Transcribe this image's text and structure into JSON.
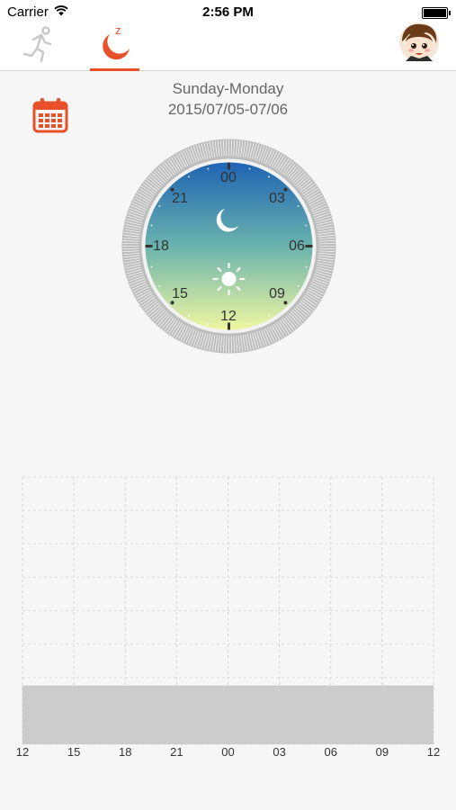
{
  "status_bar": {
    "carrier": "Carrier",
    "time": "2:56 PM"
  },
  "nav": {
    "tabs": [
      {
        "name": "activity",
        "icon": "running-man-icon",
        "active": false
      },
      {
        "name": "sleep",
        "icon": "moon-sleep-icon",
        "active": true
      }
    ],
    "accent": "#e8502a"
  },
  "header": {
    "day_range": "Sunday-Monday",
    "date_range": "2015/07/05-07/06"
  },
  "dial": {
    "hours": [
      "00",
      "03",
      "06",
      "09",
      "12",
      "15",
      "18",
      "21"
    ],
    "icons": [
      "moon-icon",
      "sun-icon"
    ]
  },
  "chart_data": {
    "type": "area",
    "x_ticks": [
      "12",
      "15",
      "18",
      "21",
      "00",
      "03",
      "06",
      "09",
      "12"
    ],
    "series": [
      {
        "values": [
          0.22,
          0.22,
          0.22,
          0.22,
          0.22,
          0.22,
          0.22,
          0.22,
          0.22
        ]
      }
    ],
    "ylim": [
      0,
      1
    ],
    "grid": true
  }
}
